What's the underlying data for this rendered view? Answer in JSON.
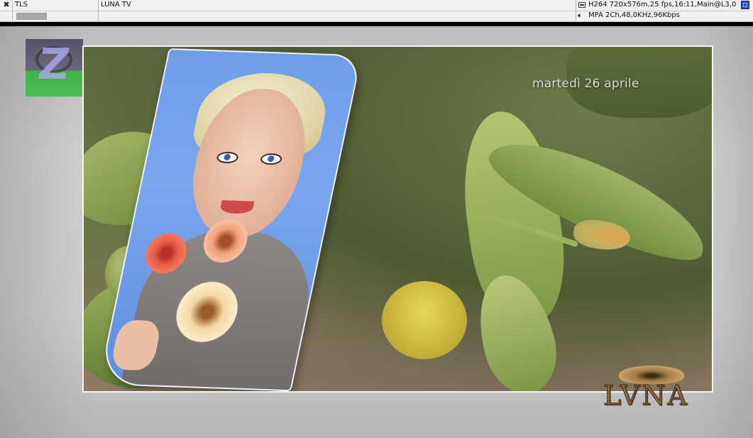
{
  "infobar": {
    "row1": {
      "source": "TLS",
      "channel": "LUNA TV",
      "video_info": "H264 720x576m,25 fps,16:11,Main@L3,0"
    },
    "row2": {
      "audio_info": "MPA 2Ch,48,0KHz,96Kbps"
    }
  },
  "video": {
    "overlay_date": "martedì 26 aprile",
    "watermark": "LVNA",
    "corner_logo": "Z"
  },
  "colors": {
    "bar_bg": "#f0f0f0",
    "accent_blue": "#2b4fb8"
  },
  "icons": {
    "close": "close-icon",
    "video": "video-icon",
    "audio": "speaker-icon",
    "window": "window-icon"
  }
}
